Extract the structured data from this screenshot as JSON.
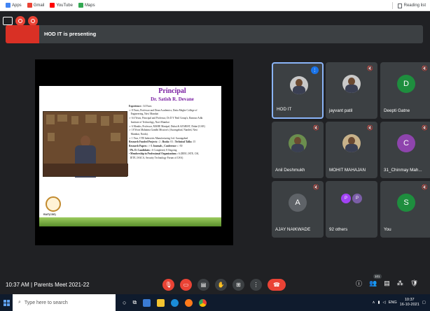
{
  "bookmarks": [
    {
      "label": "Apps",
      "color": "#4285f4",
      "icon": "apps-grid-icon"
    },
    {
      "label": "Gmail",
      "color": "#ea4335",
      "icon": "gmail-icon"
    },
    {
      "label": "YouTube",
      "color": "#ff0000",
      "icon": "youtube-icon"
    },
    {
      "label": "Maps",
      "color": "#34a853",
      "icon": "maps-icon"
    }
  ],
  "reading_list": "Reading list",
  "presenter_banner": "HOD IT is presenting",
  "slide": {
    "title": "Principal",
    "subtitle": "Dr. Satish R. Devane",
    "lines": [
      "<b>Experience :</b> 34 Years",
      "➢ 8 Years, Professor and Dean Academics, Datta Meghe College of",
      "&nbsp;&nbsp;&nbsp;Engineering, Navi Mumbai",
      "➢ 6.6 Years, Principal and Professor, Dr D Y Patil Group's, Ramrao Adik",
      "&nbsp;&nbsp;&nbsp;Institute of Technology, Navi Mumbai",
      "➢ 6 Months, Professor, MAHE Manipal, Dubai & SZABIST, Dubai (UAE)",
      "➢ 18 Years Mahatma Gandhi Mission's (Aurangabad, Nanded, Navi",
      "&nbsp;&nbsp;&nbsp;Mumbai, Noida).",
      "➢ 1 Year, CTR Industries Manufacturing Ltd. Aurangabad",
      "<b>Research Funded Projects :</b> 2 ; <b>Books:</b> 03 ; <b>Technical Talks:</b> 15",
      "<b>Research Papers : &gt; 5 Journals , Conference :</b> >50",
      "• <b>Ph. D. Candidates :</b> 6 Completed, 8 Ongoing",
      "• <b>Membership in Professional Organizations :</b> 6 (IEEE, ISTE, CSI,",
      "&nbsp;&nbsp;IETE, ISACA, Security Technology Forum of USA)"
    ],
    "logo_text": "RAIT(CSE)"
  },
  "participants": [
    {
      "name": "HOD IT",
      "type": "photo",
      "active": true,
      "speaking": true,
      "color": "#c9c9c9"
    },
    {
      "name": "jayvant patil",
      "type": "photo",
      "muted": true,
      "color": "#c9c9c9"
    },
    {
      "name": "Deepti Gatne",
      "type": "letter",
      "letter": "D",
      "muted": true,
      "color": "#1e8e3e"
    },
    {
      "name": "Anil Deshmukh",
      "type": "photo",
      "muted": true,
      "color": "#6b8e4e"
    },
    {
      "name": "MOHIT MAHAJAN",
      "type": "photo",
      "muted": true,
      "color": "#c8b28a"
    },
    {
      "name": "31_Chinmay Mah...",
      "type": "letter",
      "letter": "C",
      "muted": true,
      "color": "#8e44ad"
    },
    {
      "name": "AJAY NAIKWADE",
      "type": "letter",
      "letter": "A",
      "muted": true,
      "color": "#5f6368"
    },
    {
      "name": "92 others",
      "type": "others",
      "letters": [
        "P",
        "P"
      ],
      "colors": [
        "#a142f4",
        "#7b5ea7"
      ]
    },
    {
      "name": "You",
      "type": "letter",
      "letter": "S",
      "muted": true,
      "color": "#1e8e3e"
    }
  ],
  "bottom": {
    "time": "10:37 AM",
    "separator": "|",
    "meeting": "Parents Meet 2021-22",
    "participant_count": "101"
  },
  "taskbar": {
    "search_placeholder": "Type here to search",
    "lang": "ENG",
    "time": "10:37",
    "date": "16-10-2021"
  }
}
